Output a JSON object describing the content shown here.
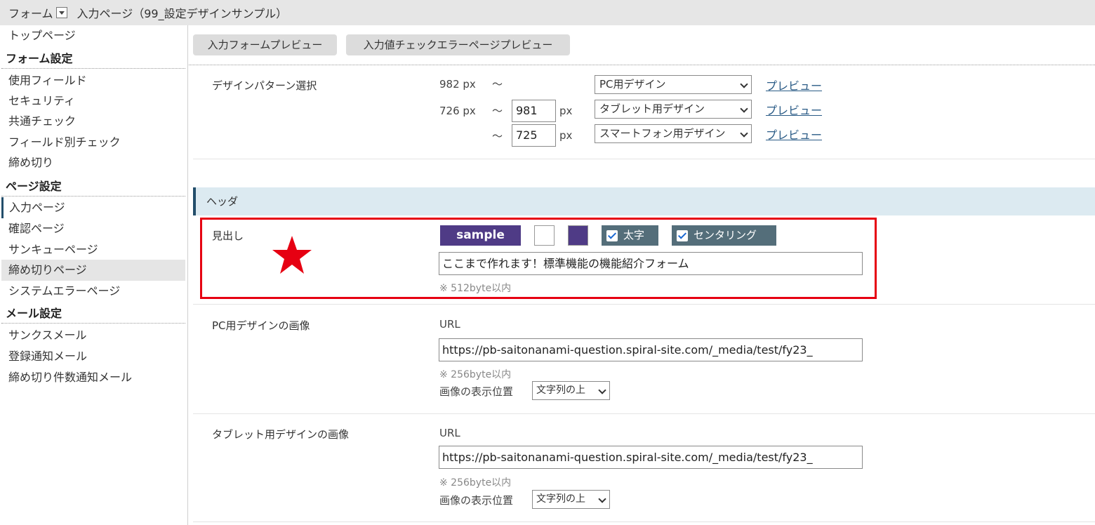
{
  "topbar": {
    "form_label": "フォーム",
    "page_title": "入力ページ（99_設定デザインサンプル）"
  },
  "sidebar": {
    "top_page": "トップページ",
    "form_settings": {
      "heading": "フォーム設定",
      "items": [
        "使用フィールド",
        "セキュリティ",
        "共通チェック",
        "フィールド別チェック",
        "締め切り"
      ]
    },
    "page_settings": {
      "heading": "ページ設定",
      "items": [
        "入力ページ",
        "確認ページ",
        "サンキューページ",
        "締め切りページ",
        "システムエラーページ"
      ]
    },
    "mail_settings": {
      "heading": "メール設定",
      "items": [
        "サンクスメール",
        "登録通知メール",
        "締め切り件数通知メール"
      ]
    }
  },
  "toolbar": {
    "preview_form": "入力フォームプレビュー",
    "preview_error": "入力値チェックエラーページプレビュー"
  },
  "design_pattern": {
    "label": "デザインパターン選択",
    "rows": [
      {
        "min_text": "982 px",
        "tilde": "～",
        "max_value": "",
        "unit": "",
        "select": "PC用デザイン",
        "link": "プレビュー"
      },
      {
        "min_text": "726 px",
        "tilde": "～",
        "max_value": "981",
        "unit": "px",
        "select": "タブレット用デザイン",
        "link": "プレビュー"
      },
      {
        "min_text": "",
        "tilde": "～",
        "max_value": "725",
        "unit": "px",
        "select": "スマートフォン用デザイン",
        "link": "プレビュー"
      }
    ]
  },
  "header_section": {
    "title": "ヘッダ",
    "heading": {
      "label": "見出し",
      "sample_text": "sample",
      "bg_color": "#ffffff",
      "text_color": "#4f3b86",
      "bold_label": "太字",
      "bold_checked": true,
      "center_label": "センタリング",
      "center_checked": true,
      "value": "ここまで作れます！標準機能の機能紹介フォーム",
      "hint": "※ 512byte以内"
    },
    "pc_image": {
      "label": "PC用デザインの画像",
      "url_label": "URL",
      "url_value": "https://pb-saitonanami-question.spiral-site.com/_media/test/fy23_",
      "hint": "※ 256byte以内",
      "position_label": "画像の表示位置",
      "position_value": "文字列の上"
    },
    "tablet_image": {
      "label": "タブレット用デザインの画像",
      "url_label": "URL",
      "url_value": "https://pb-saitonanami-question.spiral-site.com/_media/test/fy23_",
      "hint": "※ 256byte以内",
      "position_label": "画像の表示位置",
      "position_value": "文字列の上"
    }
  },
  "colors": {
    "accent": "#234e6b",
    "highlight_box": "#e60012",
    "star": "#e60012",
    "link": "#2a5b86"
  },
  "icons": {
    "dropdown": "dropdown-arrow-icon",
    "star": "star-icon",
    "checkbox": "checkbox-checked-icon"
  }
}
